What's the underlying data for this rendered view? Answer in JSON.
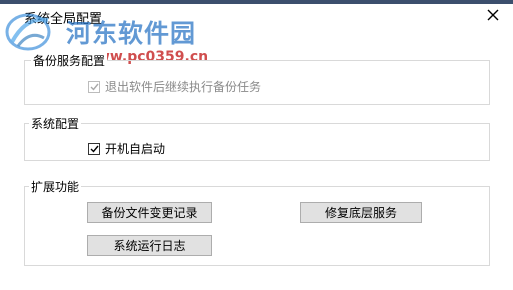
{
  "window": {
    "title": "系统全局配置"
  },
  "watermark": {
    "name": "河东软件园",
    "url": "www.pc0359.cn"
  },
  "backup_group": {
    "label": "备份服务配置",
    "continue_backup": {
      "label": "退出软件后继续执行备份任务",
      "checked": true,
      "enabled": false
    }
  },
  "system_group": {
    "label": "系统配置",
    "autostart": {
      "label": "开机自启动",
      "checked": true,
      "enabled": true
    }
  },
  "ext_group": {
    "label": "扩展功能",
    "buttons": {
      "backup_log": "备份文件变更记录",
      "repair_service": "修复底层服务",
      "system_log": "系统运行日志"
    }
  },
  "colors": {
    "accent": "#3c4f6d",
    "watermark_blue": "#2672c4",
    "watermark_red": "#c42222"
  }
}
